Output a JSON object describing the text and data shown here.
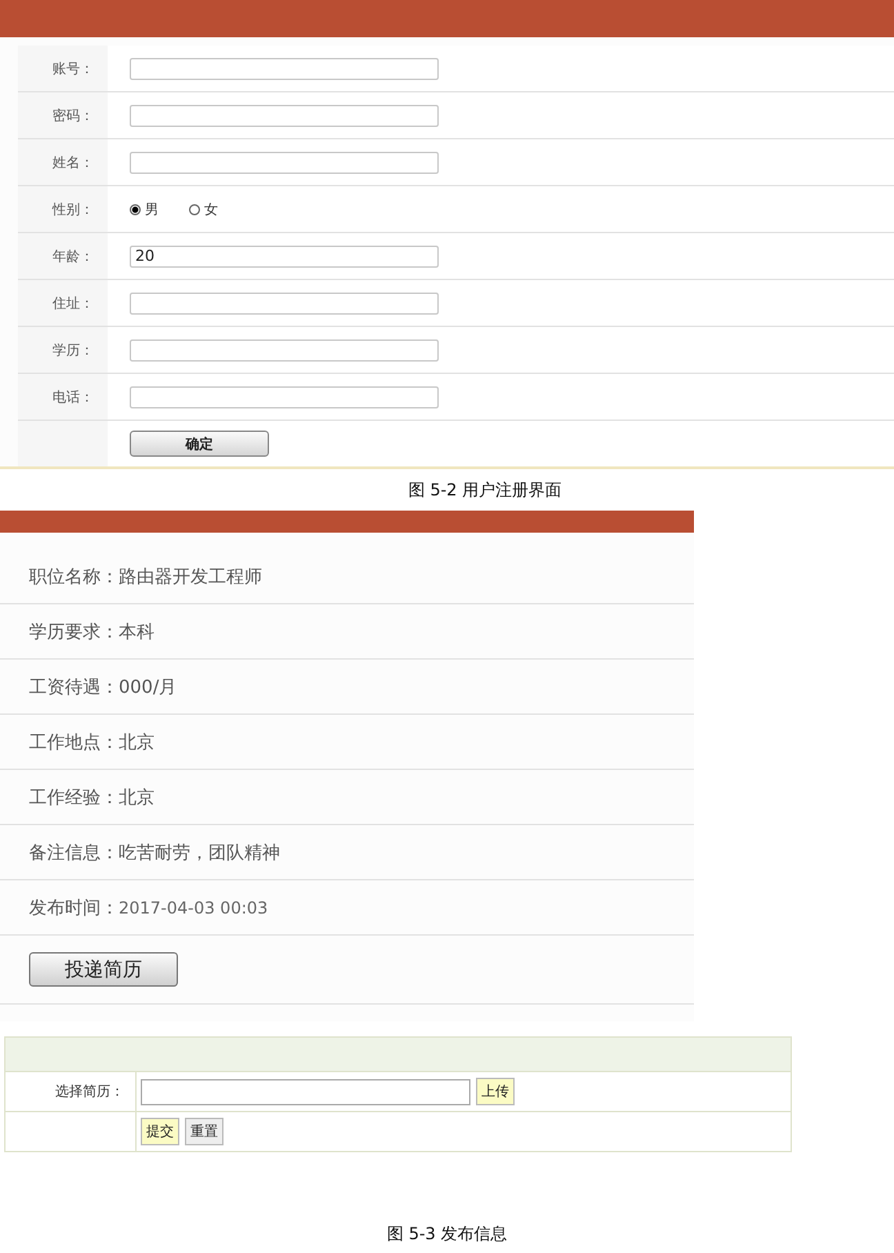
{
  "registration_form": {
    "fields": [
      {
        "kind": "text",
        "label": "账号："
      },
      {
        "kind": "text",
        "label": "密码："
      },
      {
        "kind": "text",
        "label": "姓名："
      },
      {
        "kind": "radio",
        "label": "性别：",
        "options": [
          {
            "label": "男",
            "selected": true
          },
          {
            "label": "女",
            "selected": false
          }
        ]
      },
      {
        "kind": "text",
        "label": "年龄：",
        "value": "20"
      },
      {
        "kind": "text",
        "label": "住址："
      },
      {
        "kind": "text",
        "label": "学历："
      },
      {
        "kind": "text",
        "label": "电话："
      }
    ],
    "submit_button": "确定"
  },
  "caption_1": "图 5-2 用户注册界面",
  "job_detail": {
    "rows": [
      {
        "label": "职位名称：",
        "value": "路由器开发工程师"
      },
      {
        "label": "学历要求：",
        "value": "本科"
      },
      {
        "label": "工资待遇：",
        "value": "000/月"
      },
      {
        "label": "工作地点：",
        "value": "北京"
      },
      {
        "label": "工作经验：",
        "value": "北京"
      },
      {
        "label": "备注信息：",
        "value": "吃苦耐劳，团队精神"
      },
      {
        "label": "发布时间：",
        "value": "2017-04-03 00:03"
      }
    ],
    "apply_button": "投递简历"
  },
  "resume_upload": {
    "label": "选择简历：",
    "upload_button": "上传",
    "submit_button": "提交",
    "reset_button": "重置"
  },
  "caption_2": "图 5-3 发布信息"
}
